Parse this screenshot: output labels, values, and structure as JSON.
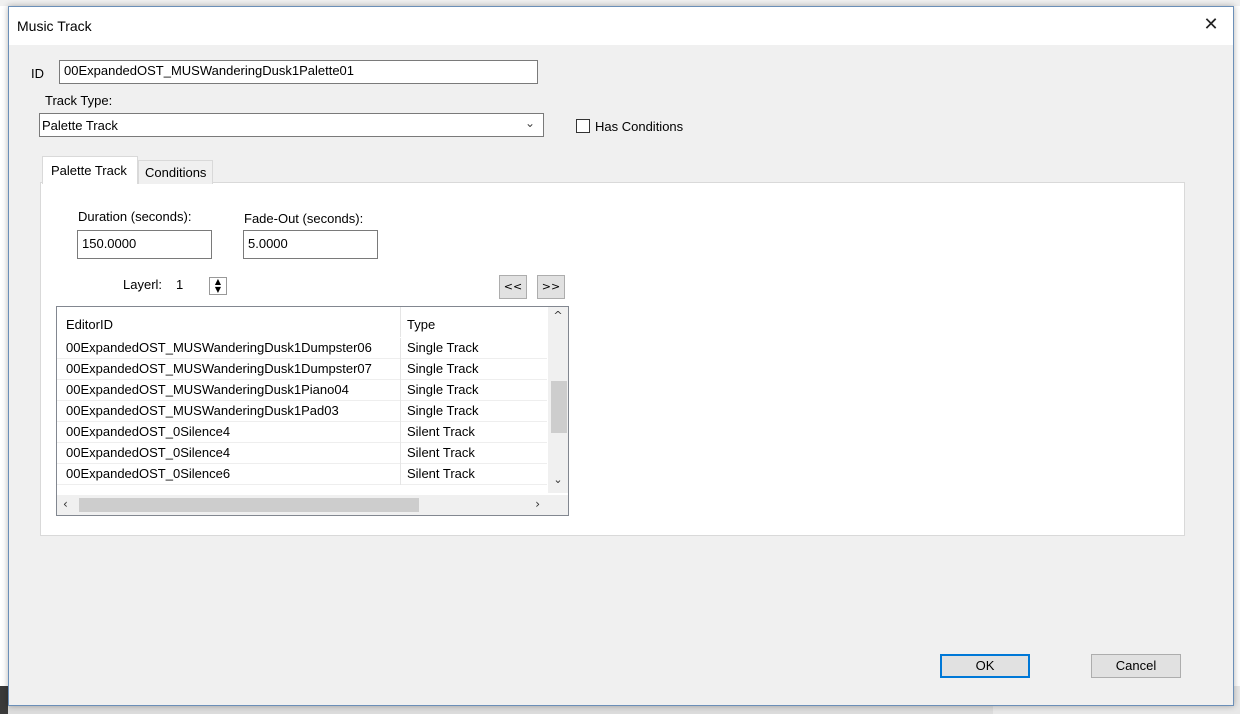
{
  "dialog": {
    "title": "Music Track",
    "close_glyph": "✕"
  },
  "form": {
    "id_label": "ID",
    "id_value": "00ExpandedOST_MUSWanderingDusk1Palette01",
    "track_type_label": "Track Type:",
    "track_type_value": "Palette Track",
    "has_conditions_label": "Has Conditions"
  },
  "tabs": [
    {
      "label": "Palette Track",
      "active": true
    },
    {
      "label": "Conditions",
      "active": false
    }
  ],
  "palette": {
    "duration_label": "Duration (seconds):",
    "duration_value": "150.0000",
    "fadeout_label": "Fade-Out (seconds):",
    "fadeout_value": "5.0000",
    "layer_label": "Layerl:",
    "layer_value": "1",
    "prev_label": "<<",
    "next_label": ">>"
  },
  "list": {
    "columns": [
      "EditorID",
      "Type"
    ],
    "rows": [
      {
        "editor_id": "00ExpandedOST_MUSWanderingDusk1Dumpster06",
        "type": "Single Track"
      },
      {
        "editor_id": "00ExpandedOST_MUSWanderingDusk1Dumpster07",
        "type": "Single Track"
      },
      {
        "editor_id": "00ExpandedOST_MUSWanderingDusk1Piano04",
        "type": "Single Track"
      },
      {
        "editor_id": "00ExpandedOST_MUSWanderingDusk1Pad03",
        "type": "Single Track"
      },
      {
        "editor_id": "00ExpandedOST_0Silence4",
        "type": "Silent Track"
      },
      {
        "editor_id": "00ExpandedOST_0Silence4",
        "type": "Silent Track"
      },
      {
        "editor_id": "00ExpandedOST_0Silence6",
        "type": "Silent Track"
      }
    ]
  },
  "buttons": {
    "ok": "OK",
    "cancel": "Cancel"
  }
}
